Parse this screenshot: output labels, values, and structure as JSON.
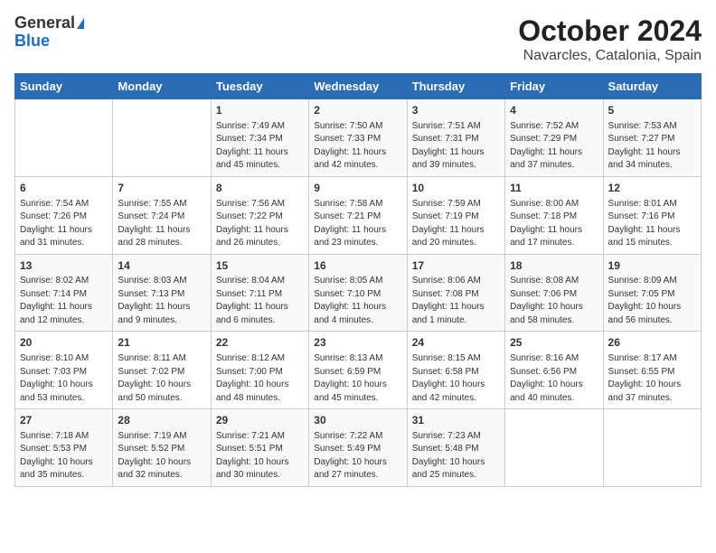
{
  "logo": {
    "general": "General",
    "blue": "Blue"
  },
  "title": "October 2024",
  "subtitle": "Navarcles, Catalonia, Spain",
  "header_days": [
    "Sunday",
    "Monday",
    "Tuesday",
    "Wednesday",
    "Thursday",
    "Friday",
    "Saturday"
  ],
  "weeks": [
    [
      {
        "day": "",
        "data": ""
      },
      {
        "day": "",
        "data": ""
      },
      {
        "day": "1",
        "data": "Sunrise: 7:49 AM\nSunset: 7:34 PM\nDaylight: 11 hours and 45 minutes."
      },
      {
        "day": "2",
        "data": "Sunrise: 7:50 AM\nSunset: 7:33 PM\nDaylight: 11 hours and 42 minutes."
      },
      {
        "day": "3",
        "data": "Sunrise: 7:51 AM\nSunset: 7:31 PM\nDaylight: 11 hours and 39 minutes."
      },
      {
        "day": "4",
        "data": "Sunrise: 7:52 AM\nSunset: 7:29 PM\nDaylight: 11 hours and 37 minutes."
      },
      {
        "day": "5",
        "data": "Sunrise: 7:53 AM\nSunset: 7:27 PM\nDaylight: 11 hours and 34 minutes."
      }
    ],
    [
      {
        "day": "6",
        "data": "Sunrise: 7:54 AM\nSunset: 7:26 PM\nDaylight: 11 hours and 31 minutes."
      },
      {
        "day": "7",
        "data": "Sunrise: 7:55 AM\nSunset: 7:24 PM\nDaylight: 11 hours and 28 minutes."
      },
      {
        "day": "8",
        "data": "Sunrise: 7:56 AM\nSunset: 7:22 PM\nDaylight: 11 hours and 26 minutes."
      },
      {
        "day": "9",
        "data": "Sunrise: 7:58 AM\nSunset: 7:21 PM\nDaylight: 11 hours and 23 minutes."
      },
      {
        "day": "10",
        "data": "Sunrise: 7:59 AM\nSunset: 7:19 PM\nDaylight: 11 hours and 20 minutes."
      },
      {
        "day": "11",
        "data": "Sunrise: 8:00 AM\nSunset: 7:18 PM\nDaylight: 11 hours and 17 minutes."
      },
      {
        "day": "12",
        "data": "Sunrise: 8:01 AM\nSunset: 7:16 PM\nDaylight: 11 hours and 15 minutes."
      }
    ],
    [
      {
        "day": "13",
        "data": "Sunrise: 8:02 AM\nSunset: 7:14 PM\nDaylight: 11 hours and 12 minutes."
      },
      {
        "day": "14",
        "data": "Sunrise: 8:03 AM\nSunset: 7:13 PM\nDaylight: 11 hours and 9 minutes."
      },
      {
        "day": "15",
        "data": "Sunrise: 8:04 AM\nSunset: 7:11 PM\nDaylight: 11 hours and 6 minutes."
      },
      {
        "day": "16",
        "data": "Sunrise: 8:05 AM\nSunset: 7:10 PM\nDaylight: 11 hours and 4 minutes."
      },
      {
        "day": "17",
        "data": "Sunrise: 8:06 AM\nSunset: 7:08 PM\nDaylight: 11 hours and 1 minute."
      },
      {
        "day": "18",
        "data": "Sunrise: 8:08 AM\nSunset: 7:06 PM\nDaylight: 10 hours and 58 minutes."
      },
      {
        "day": "19",
        "data": "Sunrise: 8:09 AM\nSunset: 7:05 PM\nDaylight: 10 hours and 56 minutes."
      }
    ],
    [
      {
        "day": "20",
        "data": "Sunrise: 8:10 AM\nSunset: 7:03 PM\nDaylight: 10 hours and 53 minutes."
      },
      {
        "day": "21",
        "data": "Sunrise: 8:11 AM\nSunset: 7:02 PM\nDaylight: 10 hours and 50 minutes."
      },
      {
        "day": "22",
        "data": "Sunrise: 8:12 AM\nSunset: 7:00 PM\nDaylight: 10 hours and 48 minutes."
      },
      {
        "day": "23",
        "data": "Sunrise: 8:13 AM\nSunset: 6:59 PM\nDaylight: 10 hours and 45 minutes."
      },
      {
        "day": "24",
        "data": "Sunrise: 8:15 AM\nSunset: 6:58 PM\nDaylight: 10 hours and 42 minutes."
      },
      {
        "day": "25",
        "data": "Sunrise: 8:16 AM\nSunset: 6:56 PM\nDaylight: 10 hours and 40 minutes."
      },
      {
        "day": "26",
        "data": "Sunrise: 8:17 AM\nSunset: 6:55 PM\nDaylight: 10 hours and 37 minutes."
      }
    ],
    [
      {
        "day": "27",
        "data": "Sunrise: 7:18 AM\nSunset: 5:53 PM\nDaylight: 10 hours and 35 minutes."
      },
      {
        "day": "28",
        "data": "Sunrise: 7:19 AM\nSunset: 5:52 PM\nDaylight: 10 hours and 32 minutes."
      },
      {
        "day": "29",
        "data": "Sunrise: 7:21 AM\nSunset: 5:51 PM\nDaylight: 10 hours and 30 minutes."
      },
      {
        "day": "30",
        "data": "Sunrise: 7:22 AM\nSunset: 5:49 PM\nDaylight: 10 hours and 27 minutes."
      },
      {
        "day": "31",
        "data": "Sunrise: 7:23 AM\nSunset: 5:48 PM\nDaylight: 10 hours and 25 minutes."
      },
      {
        "day": "",
        "data": ""
      },
      {
        "day": "",
        "data": ""
      }
    ]
  ]
}
